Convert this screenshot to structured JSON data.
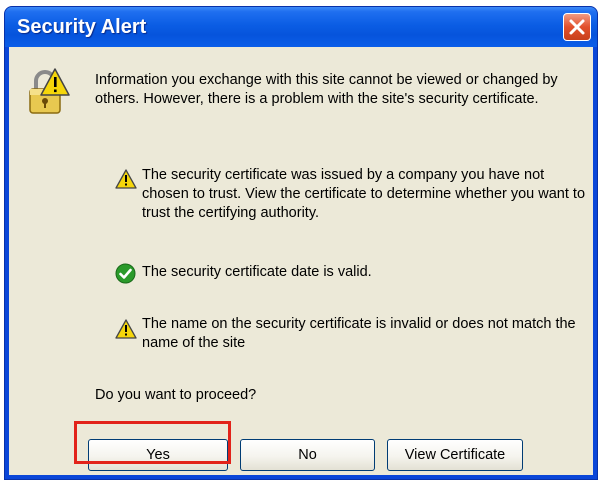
{
  "window": {
    "title": "Security Alert",
    "close_icon": "close-icon"
  },
  "message": {
    "intro": "Information you exchange with this site cannot be viewed or changed by others. However, there is a problem with the site's security certificate.",
    "items": [
      {
        "icon": "warning-icon",
        "text": "The security certificate was issued by a company you have not chosen to trust. View the certificate to determine whether you want to trust the certifying authority."
      },
      {
        "icon": "check-icon",
        "text": "The security certificate date is valid."
      },
      {
        "icon": "warning-icon",
        "text": "The name on the security certificate is invalid or does not match the name of the site"
      }
    ],
    "prompt": "Do you want to proceed?"
  },
  "buttons": {
    "yes_label": "Yes",
    "no_label": "No",
    "view_certificate_label": "View Certificate"
  },
  "colors": {
    "title_bar": "#0b5de4",
    "dialog_background": "#ece9d8",
    "highlight": "#e2231a",
    "warning": "#f5d60a",
    "check": "#2a9a2a"
  }
}
